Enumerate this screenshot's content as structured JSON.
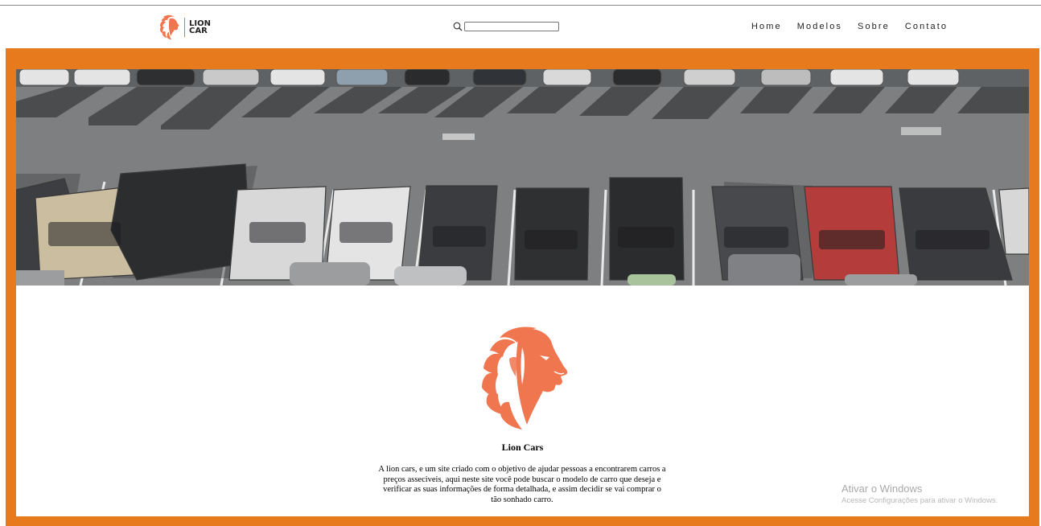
{
  "header": {
    "logo_text": "LION CAR",
    "search": {
      "value": "",
      "placeholder": ""
    },
    "nav": [
      "Home",
      "Modelos",
      "Sobre",
      "Contato"
    ]
  },
  "about": {
    "title": "Lion Cars",
    "description": "A lion cars, e um site criado com o objetivo de ajudar pessoas a encontrarem carros a preços asseciveis, aqui neste site você pode buscar o modelo de carro que deseja e verificar as suas informações de forma detalhada, e assim decidir se vai comprar o tão sonhado carro."
  },
  "watermark": {
    "title": "Ativar o Windows",
    "subtitle": "Acesse Configurações para ativar o Windows."
  },
  "colors": {
    "accent": "#e87a1e",
    "lion": "#f07650"
  },
  "icons": {
    "search": "search-icon",
    "logo": "lion-head-icon"
  }
}
